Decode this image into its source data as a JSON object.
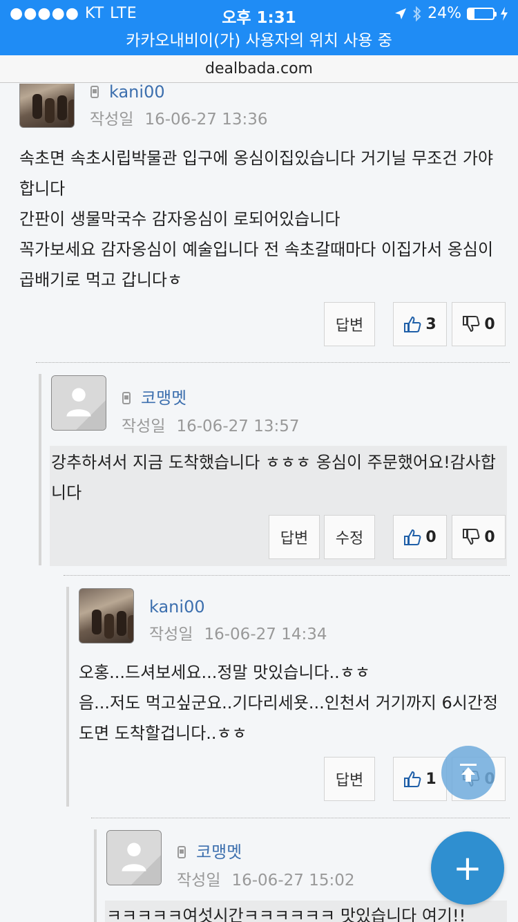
{
  "status_bar": {
    "carrier": "●●●●● KT   LTE",
    "time": "오후 1:31",
    "battery": "24%"
  },
  "location_banner": "카카오내비이(가) 사용자의 위치 사용 중",
  "url": "dealbada.com",
  "comments": [
    {
      "author": "kani00",
      "date_label": "작성일",
      "date": "16-06-27 13:36",
      "body": "속초면 속초시립박물관 입구에 옹심이집있습니다 거기닐 무조건 가야합니다\n간판이 생물막국수 감자옹심이 로되어있습니다\n꼭가보세요 감자옹심이 예술입니다 전 속초갈때마다 이집가서 옹심이곱배기로 먹고 갑니다ㅎ",
      "reply_label": "답변",
      "likes": "3",
      "dislikes": "0"
    },
    {
      "author": "코맹멧",
      "date_label": "작성일",
      "date": "16-06-27 13:57",
      "body": "강추하셔서 지금 도착했습니다 ㅎㅎㅎ 옹심이 주문했어요!감사합니다",
      "reply_label": "답변",
      "edit_label": "수정",
      "likes": "0",
      "dislikes": "0"
    },
    {
      "author": "kani00",
      "date_label": "작성일",
      "date": "16-06-27 14:34",
      "body": "오홍...드셔보세요...정말 맛있습니다..ㅎㅎ\n음...저도 먹고싶군요..기다리세욧...인천서 거기까지 6시간정도면 도착할겁니다..ㅎㅎ",
      "reply_label": "답변",
      "likes": "1",
      "dislikes": "0"
    },
    {
      "author": "코맹멧",
      "date_label": "작성일",
      "date": "16-06-27 15:02",
      "body": "ㅋㅋㅋㅋㅋ여섯시간ㅋㅋㅋㅋㅋㅋ 맛있습니다 여기!!"
    }
  ],
  "fab_add_label": "+"
}
